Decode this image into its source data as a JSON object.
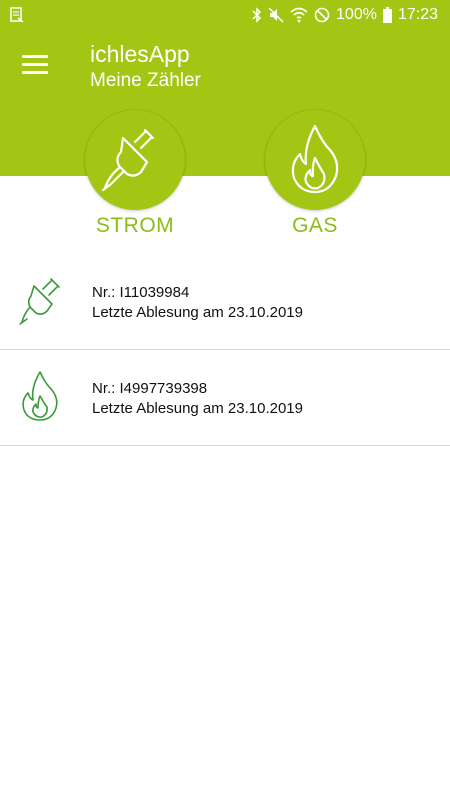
{
  "status_bar": {
    "battery": "100%",
    "time": "17:23"
  },
  "header": {
    "title": "ichlesApp",
    "subtitle": "Meine Zähler"
  },
  "tiles": [
    {
      "label": "STROM",
      "icon": "plug-icon"
    },
    {
      "label": "GAS",
      "icon": "flame-icon"
    }
  ],
  "meters": [
    {
      "number": "Nr.: I11039984",
      "last_reading": "Letzte Ablesung am 23.10.2019",
      "icon": "plug-icon"
    },
    {
      "number": "Nr.: I4997739398",
      "last_reading": "Letzte Ablesung am 23.10.2019",
      "icon": "flame-icon"
    }
  ],
  "colors": {
    "brand_green": "#a3c614",
    "label_green": "#8dbb17",
    "icon_green": "#3a9a3a",
    "divider": "#d8d8d8"
  }
}
